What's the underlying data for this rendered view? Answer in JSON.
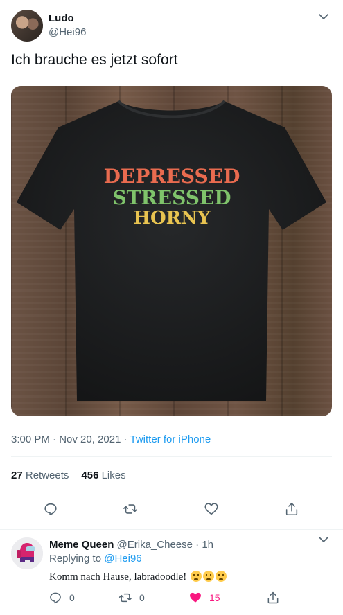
{
  "tweet": {
    "author_name": "Ludo",
    "author_handle": "@Hei96",
    "text": "Ich brauche es jetzt sofort",
    "shirt_lines": [
      "DEPRESSED",
      "STRESSED",
      "HORNY"
    ],
    "time": "3:00 PM",
    "date": "Nov 20, 2021",
    "source": "Twitter for iPhone",
    "meta_sep": " · ",
    "retweets_count": "27",
    "retweets_label": "Retweets",
    "likes_count": "456",
    "likes_label": "Likes"
  },
  "reply": {
    "author_name": "Meme Queen",
    "author_handle": "@Erika_Cheese",
    "time": "1h",
    "head_sep": " · ",
    "replying_prefix": "Replying to ",
    "replying_to": "@Hei96",
    "text": "Komm nach Hause, labradoodle!",
    "reply_count": "0",
    "retweet_count": "0",
    "like_count": "15"
  },
  "icons": [
    "chevron-down-icon",
    "reply-icon",
    "retweet-icon",
    "like-icon",
    "share-icon"
  ],
  "colors": {
    "link": "#1d9bf0",
    "secondary": "#536471",
    "like_active": "#f91880",
    "divider": "#eff3f4"
  }
}
